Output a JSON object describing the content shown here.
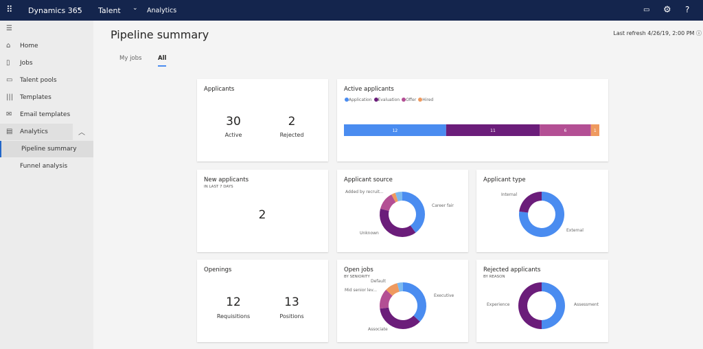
{
  "topbar": {
    "app_name": "Dynamics 365",
    "module": "Talent",
    "section": "Analytics",
    "icons": [
      "waffle-icon",
      "chat-icon",
      "gear-icon",
      "help-icon"
    ]
  },
  "sidebar": {
    "items": [
      {
        "label": "Home",
        "icon": "home-icon"
      },
      {
        "label": "Jobs",
        "icon": "jobs-icon"
      },
      {
        "label": "Talent pools",
        "icon": "talent-pools-icon"
      },
      {
        "label": "Templates",
        "icon": "templates-icon"
      },
      {
        "label": "Email templates",
        "icon": "mail-icon"
      },
      {
        "label": "Analytics",
        "icon": "analytics-icon"
      }
    ],
    "subitems": [
      {
        "label": "Pipeline summary",
        "selected": true
      },
      {
        "label": "Funnel analysis"
      }
    ]
  },
  "page": {
    "title": "Pipeline summary",
    "last_refresh": "Last refresh 4/26/19, 2:00 PM",
    "tabs": [
      {
        "label": "My jobs"
      },
      {
        "label": "All",
        "selected": true
      }
    ]
  },
  "cards": {
    "applicants": {
      "title": "Applicants",
      "active": "30",
      "active_label": "Active",
      "rejected": "2",
      "rejected_label": "Rejected"
    },
    "new_applicants": {
      "title": "New applicants",
      "subtitle": "IN LAST 7 DAYS",
      "value": "2"
    },
    "openings": {
      "title": "Openings",
      "requisitions": "12",
      "requisitions_label": "Requisitions",
      "positions": "13",
      "positions_label": "Positions"
    }
  },
  "colors": {
    "blue": "#4a8cf0",
    "purple": "#6b1d7a",
    "magenta": "#b34f94",
    "orange": "#ef9a5f",
    "lightblue": "#7cb9f0"
  },
  "chart_data": [
    {
      "type": "bar",
      "stacked": true,
      "title": "Active applicants",
      "legend": "top-left",
      "series": [
        {
          "name": "Application",
          "values": [
            12
          ],
          "color": "#4a8cf0"
        },
        {
          "name": "Evaluation",
          "values": [
            11
          ],
          "color": "#6b1d7a"
        },
        {
          "name": "Offer",
          "values": [
            6
          ],
          "color": "#b34f94"
        },
        {
          "name": "Hired",
          "values": [
            1
          ],
          "color": "#ef9a5f"
        }
      ]
    },
    {
      "type": "pie",
      "donut": true,
      "title": "Applicant source",
      "slices": [
        {
          "name": "Career fair",
          "value": 40,
          "color": "#4a8cf0"
        },
        {
          "name": "Unknown",
          "value": 39,
          "color": "#6b1d7a"
        },
        {
          "name": "Added by recruit...",
          "value": 13,
          "color": "#b34f94"
        },
        {
          "name": "",
          "value": 3,
          "color": "#ef9a5f"
        },
        {
          "name": "",
          "value": 5,
          "color": "#7cb9f0"
        }
      ]
    },
    {
      "type": "pie",
      "donut": true,
      "title": "Applicant type",
      "slices": [
        {
          "name": "External",
          "value": 77,
          "color": "#4a8cf0"
        },
        {
          "name": "Internal",
          "value": 23,
          "color": "#6b1d7a"
        }
      ]
    },
    {
      "type": "pie",
      "donut": true,
      "title": "Open jobs",
      "subtitle": "BY SENIORITY",
      "slices": [
        {
          "name": "Executive",
          "value": 37,
          "color": "#4a8cf0"
        },
        {
          "name": "Associate",
          "value": 36,
          "color": "#6b1d7a"
        },
        {
          "name": "Mid senior lev...",
          "value": 14,
          "color": "#b34f94"
        },
        {
          "name": "Default",
          "value": 9,
          "color": "#ef9a5f"
        },
        {
          "name": "",
          "value": 4,
          "color": "#7cb9f0"
        }
      ]
    },
    {
      "type": "pie",
      "donut": true,
      "title": "Rejected applicants",
      "subtitle": "BY REASON",
      "slices": [
        {
          "name": "Assessment",
          "value": 50,
          "color": "#4a8cf0"
        },
        {
          "name": "Experience",
          "value": 50,
          "color": "#6b1d7a"
        }
      ]
    }
  ]
}
